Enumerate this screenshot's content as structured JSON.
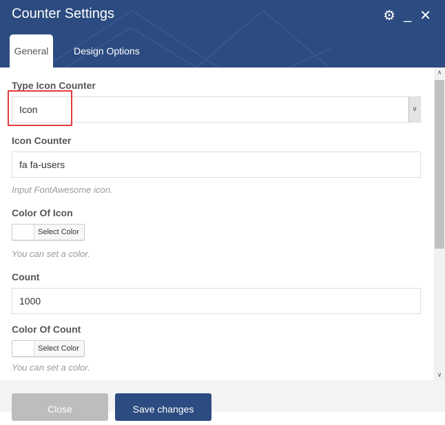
{
  "header": {
    "title": "Counter Settings",
    "icons": [
      "gear-icon",
      "minimize-icon",
      "close-icon"
    ]
  },
  "tabs": [
    {
      "label": "General",
      "active": true
    },
    {
      "label": "Design Options",
      "active": false
    }
  ],
  "form": {
    "type_icon_counter": {
      "label": "Type Icon Counter",
      "value": "Icon"
    },
    "icon_counter": {
      "label": "Icon Counter",
      "value": "fa fa-users",
      "help": "Input FontAwesome icon."
    },
    "color_of_icon": {
      "label": "Color Of Icon",
      "button": "Select Color",
      "help": "You can set a color."
    },
    "count": {
      "label": "Count",
      "value": "1000"
    },
    "color_of_count": {
      "label": "Color Of Count",
      "button": "Select Color",
      "help": "You can set a color."
    }
  },
  "footer": {
    "close": "Close",
    "save": "Save changes"
  },
  "colors": {
    "header": "#2c4b80",
    "highlight": "#e03c3c"
  }
}
